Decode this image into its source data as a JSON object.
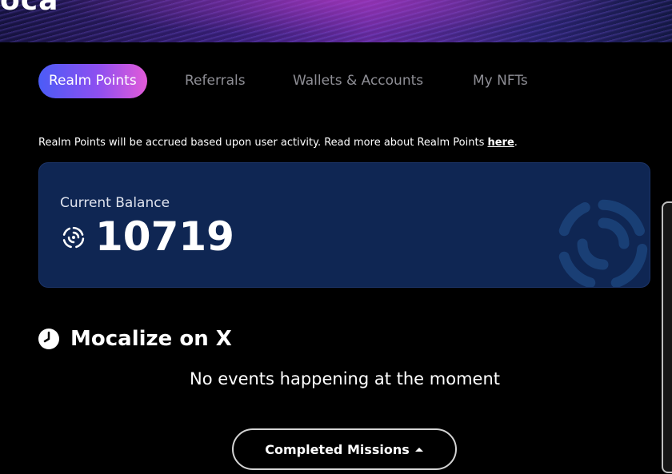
{
  "banner": {
    "brand": "oca"
  },
  "tabs": [
    {
      "label": "Realm Points",
      "active": true
    },
    {
      "label": "Referrals",
      "active": false
    },
    {
      "label": "Wallets & Accounts",
      "active": false
    },
    {
      "label": "My NFTs",
      "active": false
    }
  ],
  "info": {
    "text": "Realm Points will be accrued based upon user activity. Read more about Realm Points ",
    "link": "here",
    "suffix": "."
  },
  "balance": {
    "label": "Current Balance",
    "amount": "10719",
    "icon": "realm-points-icon"
  },
  "section": {
    "title": "Mocalize on X",
    "icon": "clock-icon",
    "empty_message": "No events happening at the moment"
  },
  "missions_button": {
    "label": "Completed Missions",
    "icon": "chevron-up-icon"
  },
  "colors": {
    "background": "#000000",
    "card": "#0f2653",
    "tab_gradient_start": "#4b5cf6",
    "tab_gradient_end": "#e25bd8",
    "inactive_tab": "#8e8e95"
  }
}
